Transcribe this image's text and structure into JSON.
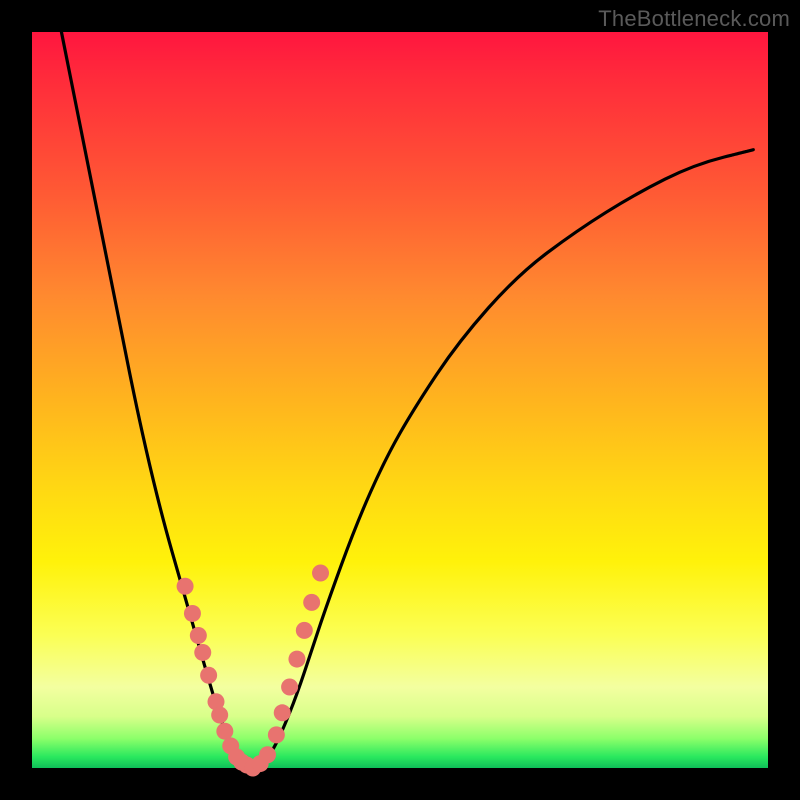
{
  "watermark": "TheBottleneck.com",
  "colors": {
    "background": "#000000",
    "curve_stroke": "#000000",
    "marker_fill": "#e8736f",
    "marker_stroke": "#d45a55"
  },
  "chart_data": {
    "type": "line",
    "title": "",
    "xlabel": "",
    "ylabel": "",
    "legend": false,
    "grid": false,
    "x": [
      0.04,
      0.06,
      0.08,
      0.1,
      0.12,
      0.14,
      0.16,
      0.18,
      0.2,
      0.22,
      0.24,
      0.255,
      0.27,
      0.28,
      0.29,
      0.3,
      0.31,
      0.325,
      0.34,
      0.36,
      0.38,
      0.4,
      0.44,
      0.48,
      0.52,
      0.58,
      0.66,
      0.74,
      0.82,
      0.9,
      0.98
    ],
    "y": [
      1.0,
      0.9,
      0.8,
      0.7,
      0.6,
      0.5,
      0.41,
      0.33,
      0.26,
      0.19,
      0.12,
      0.07,
      0.03,
      0.012,
      0.004,
      0.0,
      0.004,
      0.02,
      0.05,
      0.1,
      0.16,
      0.22,
      0.33,
      0.42,
      0.49,
      0.58,
      0.67,
      0.73,
      0.78,
      0.82,
      0.84
    ],
    "xlim": [
      0,
      1
    ],
    "ylim": [
      0,
      1
    ],
    "markers": {
      "x": [
        0.208,
        0.218,
        0.226,
        0.232,
        0.24,
        0.25,
        0.255,
        0.262,
        0.27,
        0.278,
        0.285,
        0.292,
        0.3,
        0.31,
        0.32,
        0.332,
        0.34,
        0.35,
        0.36,
        0.37,
        0.38,
        0.392
      ],
      "y": [
        0.247,
        0.21,
        0.18,
        0.157,
        0.126,
        0.09,
        0.072,
        0.05,
        0.03,
        0.015,
        0.008,
        0.004,
        0.0,
        0.006,
        0.018,
        0.045,
        0.075,
        0.11,
        0.148,
        0.187,
        0.225,
        0.265
      ]
    }
  }
}
